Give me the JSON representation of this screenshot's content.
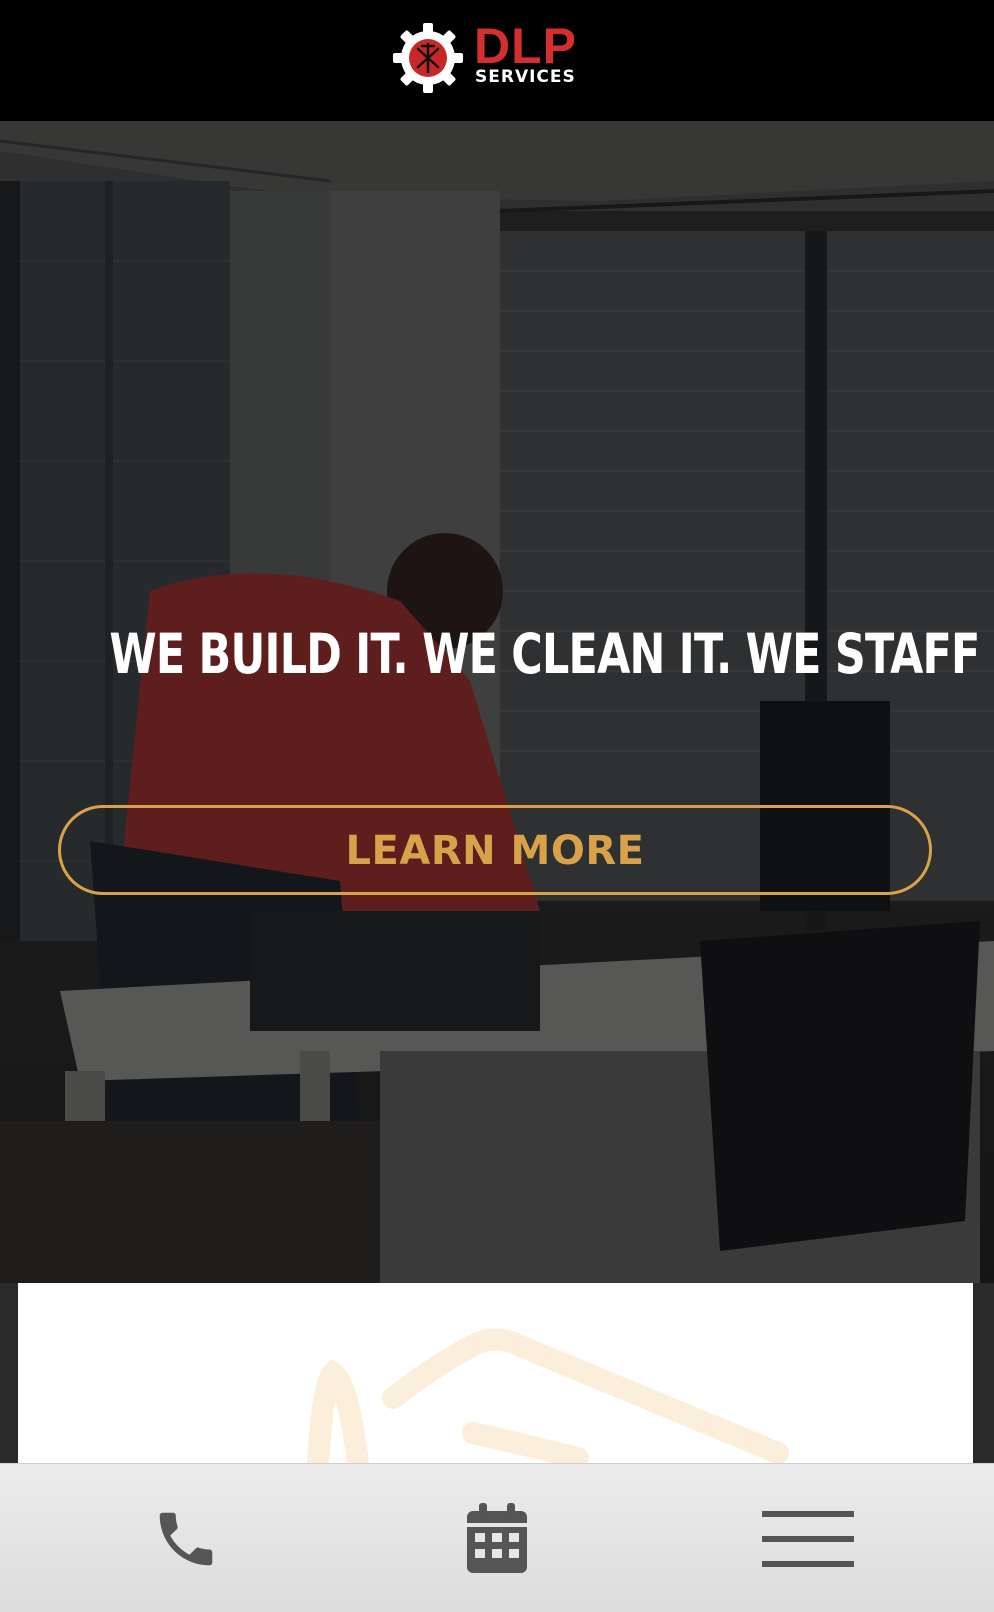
{
  "header": {
    "logo": {
      "word": "DLP",
      "sub": "SERVICES"
    }
  },
  "hero": {
    "heading": "WE BUILD IT. WE CLEAN IT. WE STAFF IT.",
    "cta_label": "LEARN MORE"
  },
  "bottom_bar": {
    "items": [
      {
        "icon": "phone-icon"
      },
      {
        "icon": "calendar-icon"
      },
      {
        "icon": "menu-icon"
      }
    ]
  },
  "colors": {
    "header_bg": "#000000",
    "brand_red": "#d32f2f",
    "accent_gold": "#d9a24a",
    "icon_gray": "#555555",
    "bar_bg": "#e6e6e6"
  }
}
